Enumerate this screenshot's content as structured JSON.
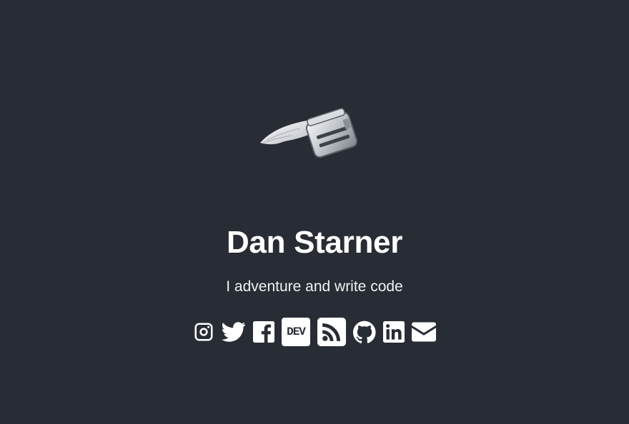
{
  "profile": {
    "name": "Dan Starner",
    "tagline": "I adventure and write code"
  },
  "logo": {
    "icon": "flying-toaster-icon"
  },
  "socials": [
    {
      "icon": "instagram-icon"
    },
    {
      "icon": "twitter-icon"
    },
    {
      "icon": "facebook-icon"
    },
    {
      "icon": "dev-icon",
      "label": "DEV"
    },
    {
      "icon": "rss-icon"
    },
    {
      "icon": "github-icon"
    },
    {
      "icon": "linkedin-icon"
    },
    {
      "icon": "email-icon"
    }
  ],
  "colors": {
    "background": "#282c35",
    "text": "#ffffff"
  }
}
